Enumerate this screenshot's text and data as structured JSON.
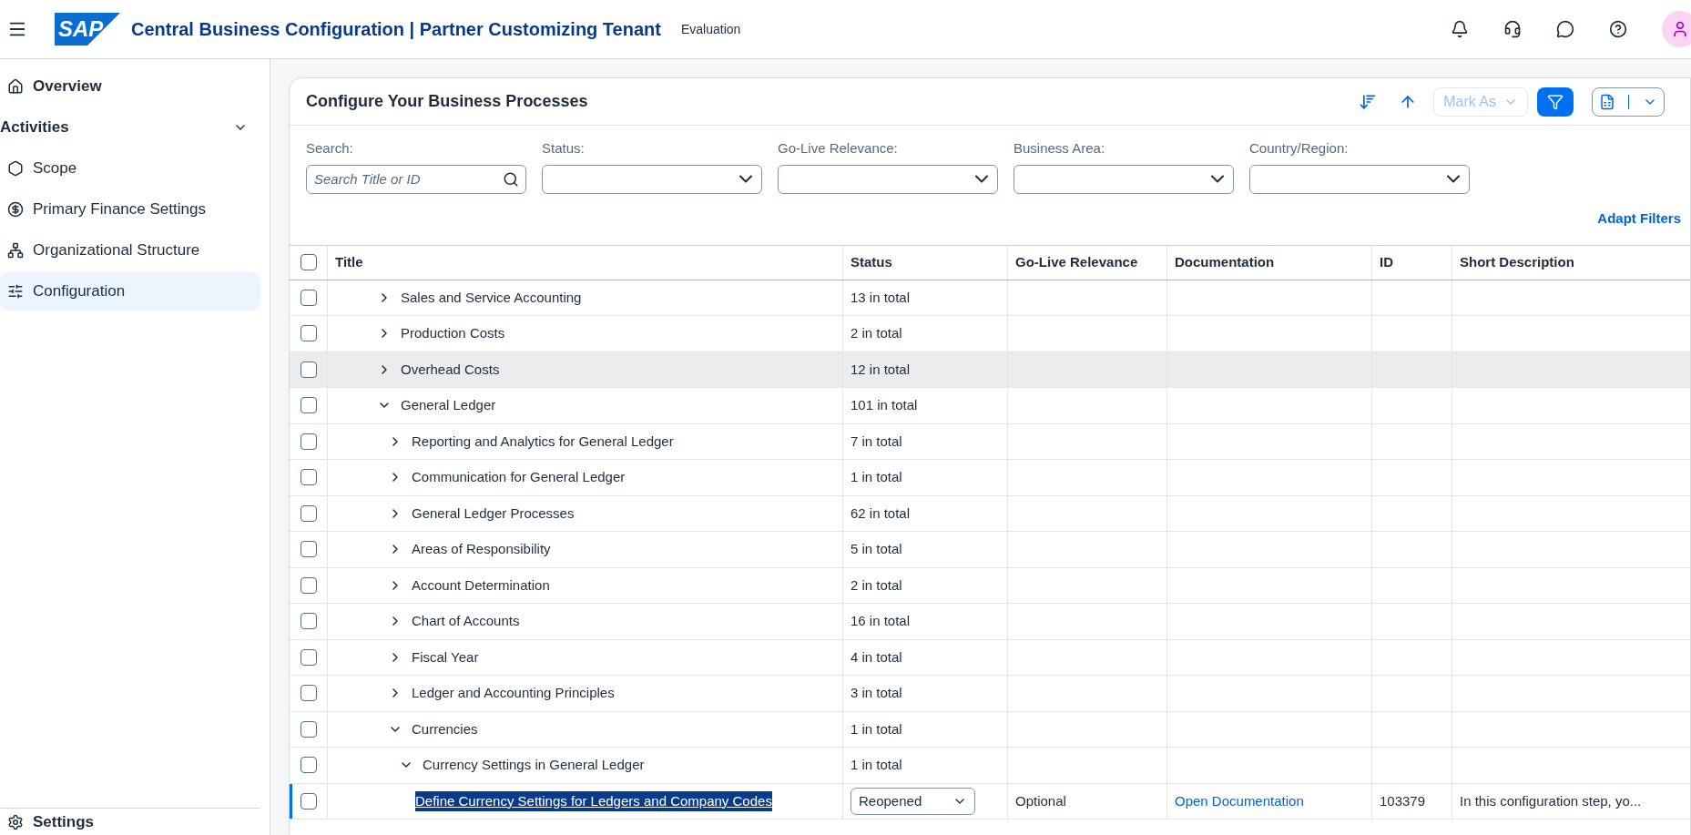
{
  "shell": {
    "logo": "SAP",
    "title": "Central Business Configuration | Partner Customizing Tenant",
    "badge": "Evaluation"
  },
  "sidebar": {
    "items": [
      {
        "kind": "link",
        "label": "Overview",
        "selected": false
      },
      {
        "kind": "group",
        "label": "Activities",
        "expanded": true
      },
      {
        "kind": "item",
        "label": "Scope",
        "selected": false
      },
      {
        "kind": "item",
        "label": "Primary Finance Settings",
        "selected": false
      },
      {
        "kind": "item",
        "label": "Organizational Structure",
        "selected": false
      },
      {
        "kind": "item",
        "label": "Configuration",
        "selected": true
      }
    ],
    "footer": "Settings"
  },
  "panel": {
    "title": "Configure Your Business Processes",
    "mark_as": "Mark As",
    "filter_on": true,
    "filters": [
      {
        "kind": "search",
        "label": "Search:",
        "placeholder": "Search Title or ID"
      },
      {
        "kind": "select",
        "label": "Status:"
      },
      {
        "kind": "select",
        "label": "Go-Live Relevance:"
      },
      {
        "kind": "select",
        "label": "Business Area:"
      },
      {
        "kind": "select",
        "label": "Country/Region:"
      }
    ],
    "adapt_filters": "Adapt Filters"
  },
  "table": {
    "all_checked": false,
    "columns": [
      "Title",
      "Status",
      "Go-Live Relevance",
      "Documentation",
      "ID",
      "Short Description"
    ],
    "rows": [
      {
        "title": "Sales and Service Accounting",
        "status": "13 in total",
        "checked": false,
        "expanded": false,
        "highlighted": false
      },
      {
        "title": "Production Costs",
        "status": "2 in total",
        "checked": false,
        "expanded": false,
        "highlighted": false
      },
      {
        "title": "Overhead Costs",
        "status": "12 in total",
        "checked": false,
        "expanded": false,
        "highlighted": true
      },
      {
        "title": "General Ledger",
        "status": "101 in total",
        "checked": false,
        "expanded": true,
        "highlighted": false,
        "children": [
          {
            "title": "Reporting and Analytics for General Ledger",
            "status": "7 in total",
            "checked": false,
            "expanded": false,
            "highlighted": false
          },
          {
            "title": "Communication for General Ledger",
            "status": "1 in total",
            "checked": false,
            "expanded": false,
            "highlighted": false
          },
          {
            "title": "General Ledger Processes",
            "status": "62 in total",
            "checked": false,
            "expanded": false,
            "highlighted": false
          },
          {
            "title": "Areas of Responsibility",
            "status": "5 in total",
            "checked": false,
            "expanded": false,
            "highlighted": false
          },
          {
            "title": "Account Determination",
            "status": "2 in total",
            "checked": false,
            "expanded": false,
            "highlighted": false
          },
          {
            "title": "Chart of Accounts",
            "status": "16 in total",
            "checked": false,
            "expanded": false,
            "highlighted": false
          },
          {
            "title": "Fiscal Year",
            "status": "4 in total",
            "checked": false,
            "expanded": false,
            "highlighted": false
          },
          {
            "title": "Ledger and Accounting Principles",
            "status": "3 in total",
            "checked": false,
            "expanded": false,
            "highlighted": false
          },
          {
            "title": "Currencies",
            "status": "1 in total",
            "checked": false,
            "expanded": true,
            "highlighted": false,
            "children": [
              {
                "title": "Currency Settings in General Ledger",
                "status": "1 in total",
                "checked": false,
                "expanded": true,
                "highlighted": false,
                "children": [
                  {
                    "kind": "step",
                    "title": "Define Currency Settings for Ledgers and Company Codes",
                    "status": "Reopened",
                    "go_live": "Optional",
                    "documentation": "Open Documentation",
                    "id": "103379",
                    "description": "In this configuration step, yo...",
                    "checked": false,
                    "selected": true
                  }
                ]
              }
            ]
          }
        ]
      }
    ]
  }
}
